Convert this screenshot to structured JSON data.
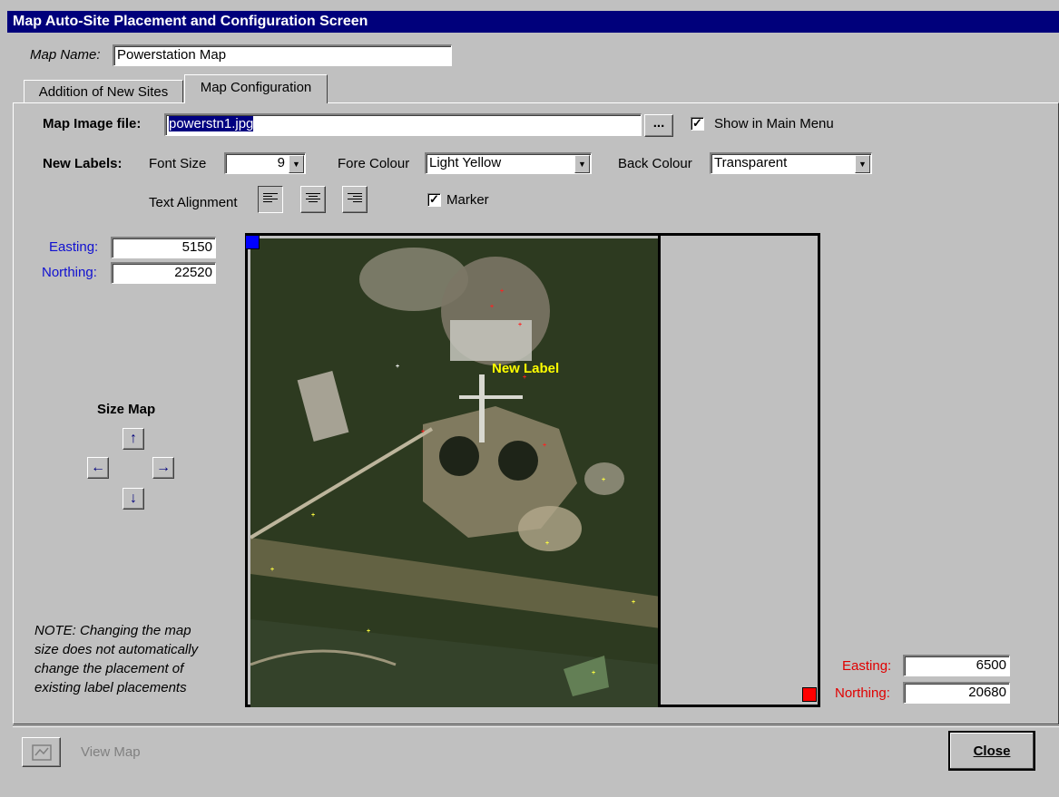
{
  "window": {
    "title": "Map Auto-Site Placement and Configuration Screen"
  },
  "map_name": {
    "label": "Map Name:",
    "value": "Powerstation Map"
  },
  "tabs": [
    {
      "label": "Addition of New Sites",
      "active": false
    },
    {
      "label": "Map Configuration",
      "active": true
    }
  ],
  "config": {
    "image_file_label": "Map Image file:",
    "image_file_value": "powerstn1.jpg",
    "browse_label": "...",
    "show_in_main_menu_label": "Show in Main Menu",
    "show_in_main_menu_checked": true,
    "new_labels_label": "New Labels:",
    "font_size_label": "Font Size",
    "font_size_value": "9",
    "fore_colour_label": "Fore Colour",
    "fore_colour_value": "Light Yellow",
    "back_colour_label": "Back Colour",
    "back_colour_value": "Transparent",
    "text_alignment_label": "Text Alignment",
    "marker_label": "Marker",
    "marker_checked": true
  },
  "top_left_coords": {
    "easting_label": "Easting:",
    "easting_value": "5150",
    "northing_label": "Northing:",
    "northing_value": "22520"
  },
  "bottom_right_coords": {
    "easting_label": "Easting:",
    "easting_value": "6500",
    "northing_label": "Northing:",
    "northing_value": "20680"
  },
  "size_map": {
    "title": "Size Map"
  },
  "map": {
    "new_label_text": "New Label",
    "site_label_text": "+",
    "site_markers": [
      {
        "color": "#ff2020"
      },
      {
        "color": "#ff2020"
      },
      {
        "color": "#ffffff"
      },
      {
        "color": "#ff2020"
      },
      {
        "color": "#ff2020"
      },
      {
        "color": "#ff2020"
      },
      {
        "color": "#ffff40"
      },
      {
        "color": "#ffff40"
      },
      {
        "color": "#ffff40"
      },
      {
        "color": "#ffff40"
      },
      {
        "color": "#ffff40"
      },
      {
        "color": "#ffff40"
      },
      {
        "color": "#ffff40"
      },
      {
        "color": "#ff2020"
      }
    ]
  },
  "note": {
    "lines": [
      "NOTE: Changing the map",
      "size does not automatically",
      "change the placement of",
      "existing label placements"
    ]
  },
  "footer": {
    "view_map_label": "View Map",
    "close_label": "Close"
  },
  "colors": {
    "titlebar": "#00007b",
    "coord_blue": "#1010d0",
    "coord_red": "#e00000",
    "handle_tl": "#0000ff",
    "handle_br": "#ff0000",
    "new_label": "#ffff00"
  }
}
